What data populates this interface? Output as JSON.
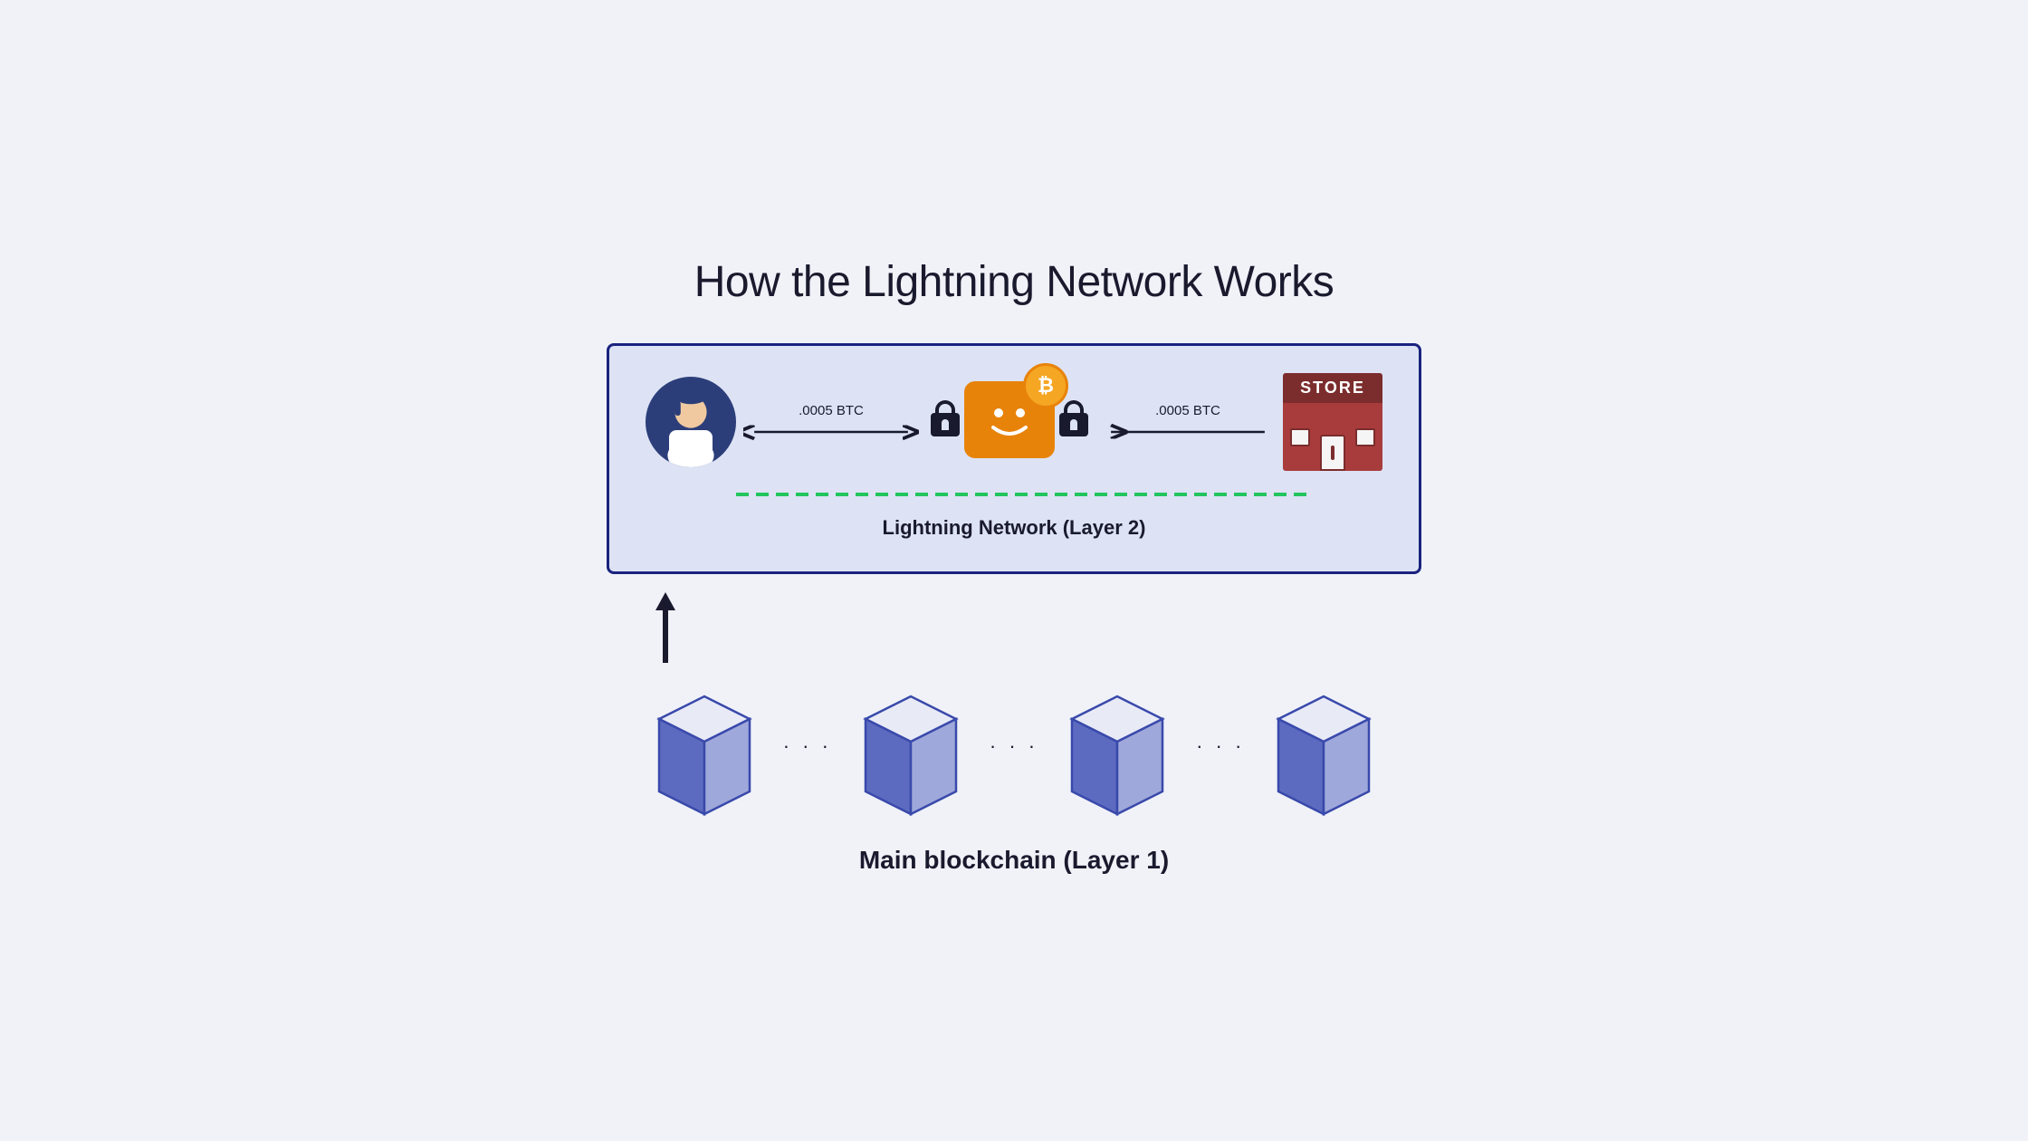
{
  "title": "How the Lightning Network Works",
  "lightning_panel": {
    "left_btc_label": ".0005 BTC",
    "right_btc_label": ".0005 BTC",
    "layer_label": "Lightning Network (Layer 2)"
  },
  "store": {
    "sign_text": "STORE"
  },
  "blockchain": {
    "label": "Main blockchain (Layer 1)",
    "block_count": 4
  }
}
